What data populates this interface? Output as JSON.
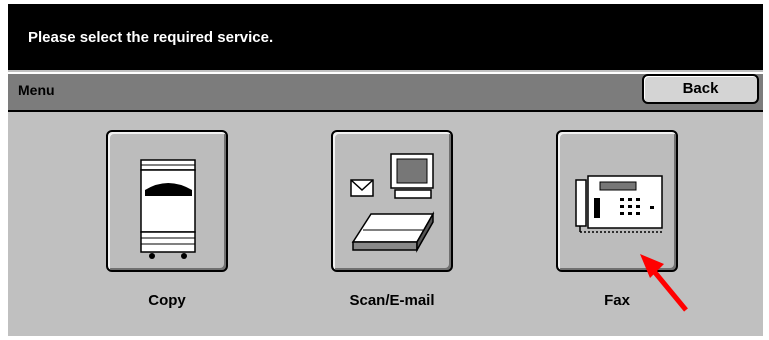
{
  "header": {
    "title": "Please select the required service."
  },
  "menu_bar": {
    "label": "Menu",
    "back_label": "Back"
  },
  "services": [
    {
      "label": "Copy",
      "icon": "copier-icon"
    },
    {
      "label": "Scan/E-mail",
      "icon": "scanner-email-icon"
    },
    {
      "label": "Fax",
      "icon": "fax-icon"
    }
  ],
  "annotation": {
    "icon": "red-arrow-pointer",
    "color": "#ff0000"
  }
}
